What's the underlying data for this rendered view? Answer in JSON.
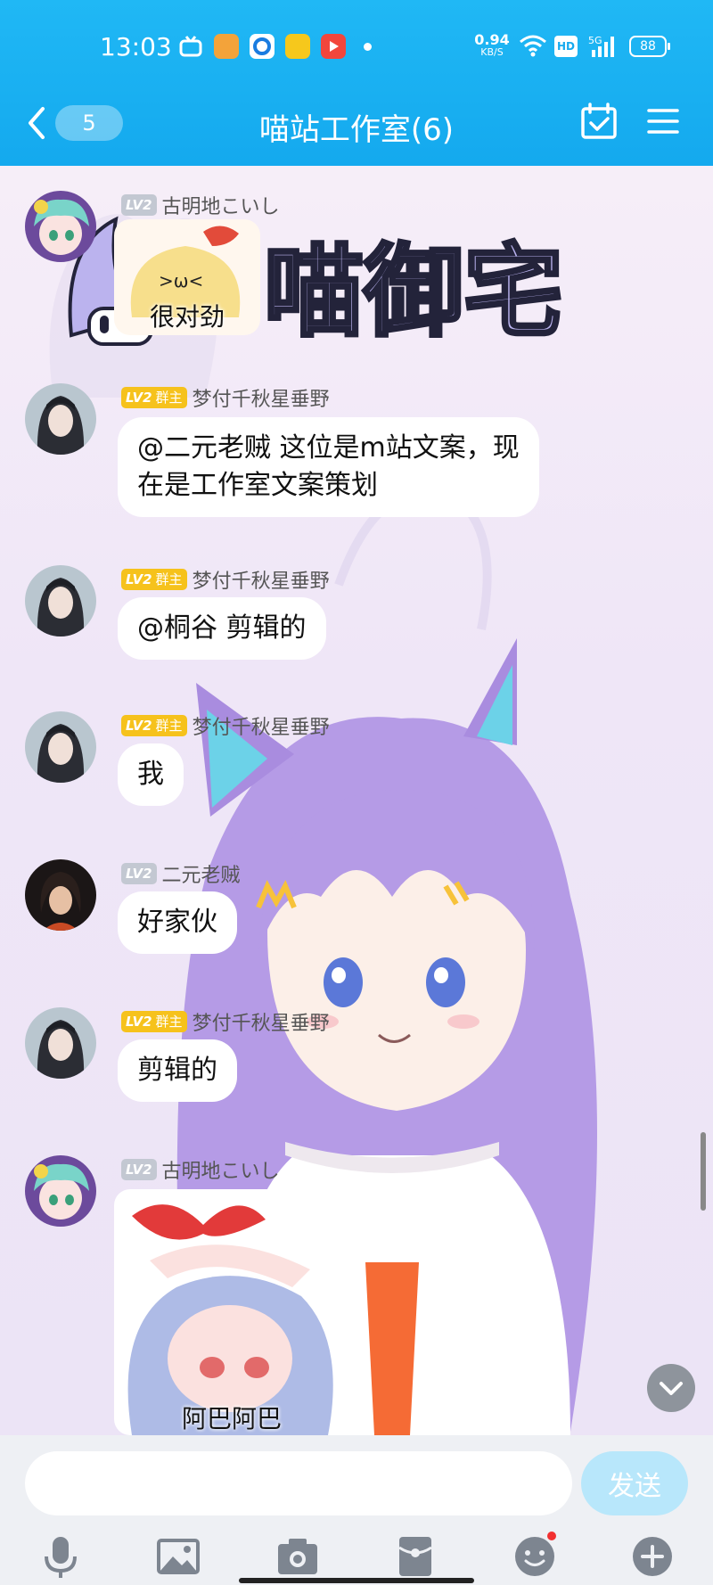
{
  "status_bar": {
    "time": "13:03",
    "net_speed": "0.94",
    "net_unit": "KB/S",
    "hd": "HD",
    "signal": "5G",
    "battery": "88"
  },
  "nav": {
    "unread_count": "5",
    "title": "喵站工作室(6)"
  },
  "background_art_text": "喵御宅",
  "messages": [
    {
      "level": "LV2",
      "role": "",
      "name": "古明地こいし",
      "type": "sticker",
      "caption": "很对劲"
    },
    {
      "level": "LV2",
      "role": "群主",
      "name": "梦付千秋星垂野",
      "type": "text",
      "text_line1": "@二元老贼 这位是m站文案，现",
      "text_line2": "在是工作室文案策划"
    },
    {
      "level": "LV2",
      "role": "群主",
      "name": "梦付千秋星垂野",
      "type": "text",
      "text": "@桐谷 剪辑的"
    },
    {
      "level": "LV2",
      "role": "群主",
      "name": "梦付千秋星垂野",
      "type": "text",
      "text": "我"
    },
    {
      "level": "LV2",
      "role": "",
      "name": "二元老贼",
      "type": "text",
      "text": "好家伙"
    },
    {
      "level": "LV2",
      "role": "群主",
      "name": "梦付千秋星垂野",
      "type": "text",
      "text": "剪辑的"
    },
    {
      "level": "LV2",
      "role": "",
      "name": "古明地こいし",
      "type": "sticker",
      "caption": "阿巴阿巴"
    }
  ],
  "input": {
    "placeholder": "",
    "send_label": "发送"
  },
  "toolbar_icons": [
    "microphone-icon",
    "image-icon",
    "camera-icon",
    "red-packet-icon",
    "emoji-icon",
    "plus-icon"
  ],
  "colors": {
    "header": "#14a9ee",
    "owner_badge": "#f6c21c",
    "level_badge": "#c3c8d2",
    "send_button": "#b8e7fb"
  }
}
